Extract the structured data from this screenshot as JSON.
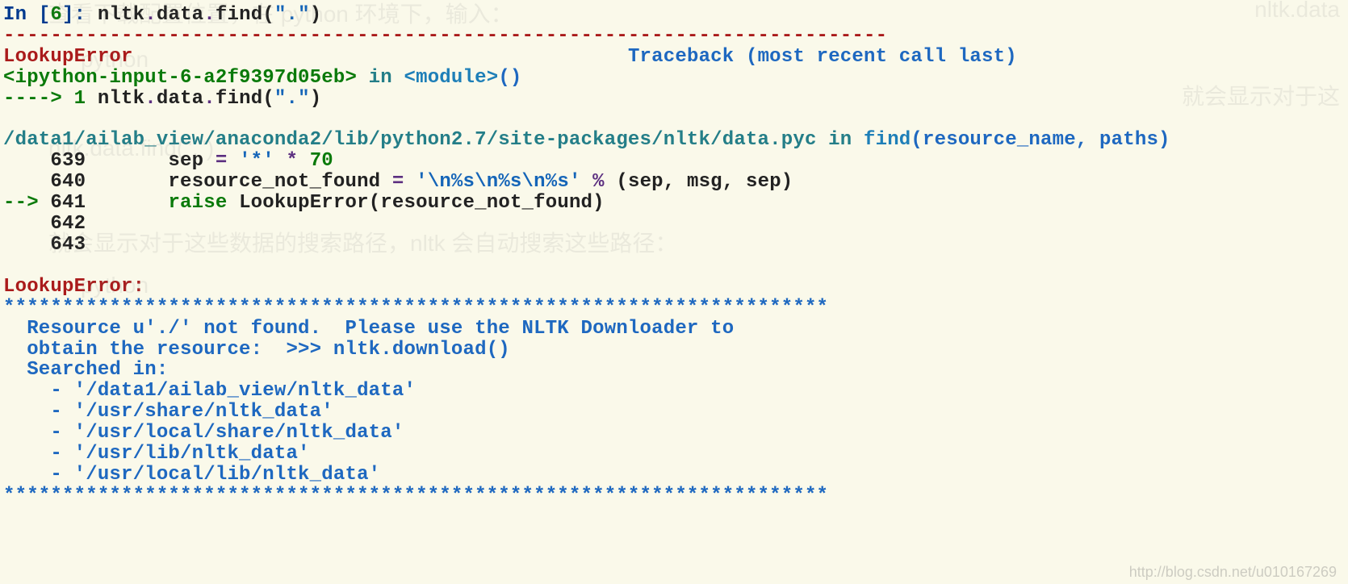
{
  "prompt": {
    "in_label": "In [",
    "n": "6",
    "in_close": "]: ",
    "obj": "nltk",
    "dot1": ".",
    "attr1": "data",
    "dot2": ".",
    "attr2": "find",
    "lparen": "(",
    "arg": "\".\"",
    "rparen": ")"
  },
  "dashline": "---------------------------------------------------------------------------",
  "tb": {
    "err_name": "LookupError",
    "spacer1": "                                          ",
    "tb_label": "Traceback (most recent call last)",
    "ipy_tag": "<ipython-input-6-a2f9397d05eb>",
    "in_word": " in ",
    "module_tag": "<module>",
    "parens": "()",
    "arrow1": "----> 1 ",
    "line1_obj": "nltk",
    "line1_d1": ".",
    "line1_a1": "data",
    "line1_d2": ".",
    "line1_a2": "find",
    "line1_lp": "(",
    "line1_arg": "\".\"",
    "line1_rp": ")"
  },
  "src": {
    "path": "/data1/ailab_view/anaconda2/lib/python2.7/site-packages/nltk/data.pyc",
    "in_word": " in ",
    "fn": "find",
    "sig": "(resource_name, paths)",
    "l639_no": "    639",
    "l639_code_pre": "       sep ",
    "l639_eq": "=",
    "l639_sp": " ",
    "l639_str": "'*'",
    "l639_mul": " * ",
    "l639_num": "70",
    "l640_no": "    640",
    "l640_code_pre": "       resource_not_found ",
    "l640_eq": "=",
    "l640_sp": " ",
    "l640_str": "'\\n%s\\n%s\\n%s'",
    "l640_pct": " % ",
    "l640_tuple": "(sep, msg, sep)",
    "l641_arrow": "--> ",
    "l641_no": "641",
    "l641_pre": "       ",
    "l641_raise": "raise",
    "l641_sp": " ",
    "l641_exc": "LookupError",
    "l641_args": "(resource_not_found)",
    "l642_no": "    642",
    "l643_no": "    643"
  },
  "msg": {
    "name": "LookupError",
    "colon": ": ",
    "stars": "**********************************************************************",
    "r1": "  Resource u'./' not found.  Please use the NLTK Downloader to",
    "r2": "  obtain the resource:  >>> nltk.download()",
    "r3": "  Searched in:",
    "r4": "    - '/data1/ailab_view/nltk_data'",
    "r5": "    - '/usr/share/nltk_data'",
    "r6": "    - '/usr/local/share/nltk_data'",
    "r7": "    - '/usr/lib/nltk_data'",
    "r8": "    - '/usr/local/lib/nltk_data'"
  },
  "watermark": "http://blog.csdn.net/u010167269",
  "bg": {
    "t1": "查看下载配置位置，在 python 环境下，输入：",
    "t2": "nltk.data",
    "t3": "python",
    "t4": "nltk.data.find(\".\")",
    "t5": "就会显示对于这些数据的搜索路径，nltk 会自动搜索这些路径：",
    "t6": "python",
    "t7": "就会显示对于这"
  },
  "colors": {
    "bg": "#faf9ea",
    "red": "#aa1b1b",
    "green": "#0a7a0a",
    "blue": "#1e68c0",
    "teal": "#247e88",
    "cyan": "#1e7fb8",
    "purple": "#5c2f80"
  }
}
